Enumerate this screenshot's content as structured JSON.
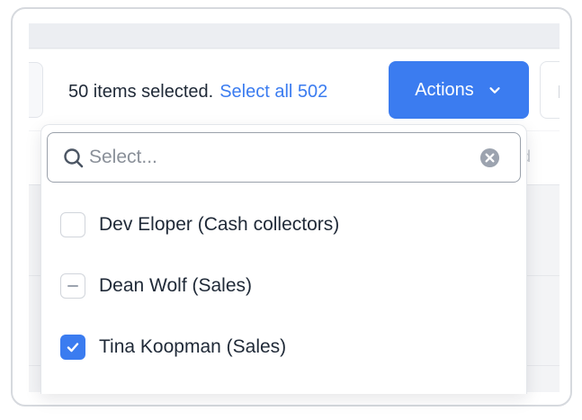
{
  "toolbar": {
    "selected_text": "50 items selected.",
    "select_all_label": "Select all 502",
    "actions_label": "Actions"
  },
  "table": {
    "ghost_header_char": "d"
  },
  "dropdown": {
    "search": {
      "placeholder": "Select...",
      "value": ""
    },
    "options": [
      {
        "label": "Dev Eloper (Cash collectors)",
        "state": "unchecked"
      },
      {
        "label": "Dean Wolf (Sales)",
        "state": "indeterminate"
      },
      {
        "label": "Tina Koopman (Sales)",
        "state": "checked"
      }
    ]
  },
  "colors": {
    "accent": "#3b7cf0",
    "text": "#1f2937",
    "border": "#d1d5db"
  }
}
